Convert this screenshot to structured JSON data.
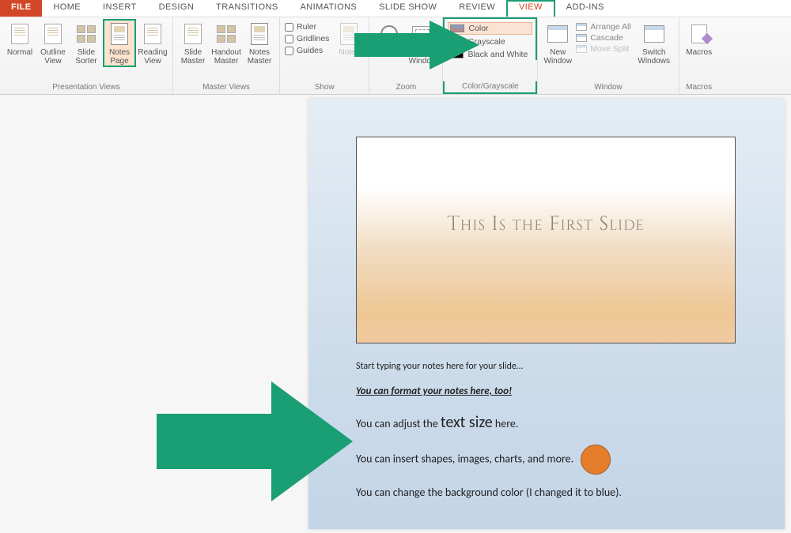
{
  "tabs": {
    "file": "FILE",
    "home": "HOME",
    "insert": "INSERT",
    "design": "DESIGN",
    "transitions": "TRANSITIONS",
    "animations": "ANIMATIONS",
    "slideshow": "SLIDE SHOW",
    "review": "REVIEW",
    "view": "VIEW",
    "addins": "ADD-INS"
  },
  "ribbon": {
    "presentation_views": {
      "label": "Presentation Views",
      "normal": "Normal",
      "outline": "Outline\nView",
      "sorter": "Slide\nSorter",
      "notes_page": "Notes\nPage",
      "reading": "Reading\nView"
    },
    "master_views": {
      "label": "Master Views",
      "slide": "Slide\nMaster",
      "handout": "Handout\nMaster",
      "notes": "Notes\nMaster"
    },
    "show": {
      "label": "Show",
      "ruler": "Ruler",
      "gridlines": "Gridlines",
      "guides": "Guides",
      "notes": "Notes"
    },
    "zoom": {
      "label": "Zoom",
      "zoom": "Zoom",
      "fit": "Fit to\nWindow"
    },
    "color_grayscale": {
      "label": "Color/Grayscale",
      "color": "Color",
      "grayscale": "Grayscale",
      "bw": "Black and White"
    },
    "window": {
      "label": "Window",
      "new": "New\nWindow",
      "arrange": "Arrange All",
      "cascade": "Cascade",
      "move_split": "Move Split",
      "switch": "Switch\nWindows"
    },
    "macros": {
      "label": "Macros",
      "macros": "Macros"
    }
  },
  "slide": {
    "title": "This Is the First Slide"
  },
  "notes": {
    "line1": "Start typing your notes here for your slide…",
    "line2": "You can format your notes here, too!",
    "line3a": "You can adjust the ",
    "line3b": "text size",
    "line3c": " here.",
    "line4": "You can insert shapes, images, charts, and more.",
    "line5": "You can change the background color (I changed it to blue)."
  },
  "colors": {
    "accent": "#1a9e73",
    "file_tab": "#d24726"
  }
}
